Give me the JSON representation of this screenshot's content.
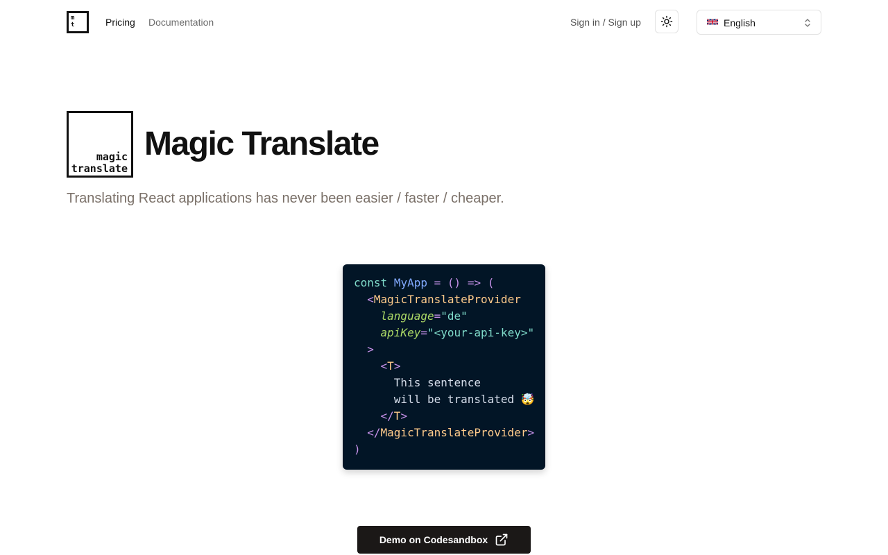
{
  "header": {
    "logo_lines": [
      "m",
      "t"
    ],
    "nav": [
      {
        "label": "Pricing"
      },
      {
        "label": "Documentation"
      }
    ],
    "auth_label": "Sign in / Sign up",
    "theme_icon": "sun-icon",
    "language": {
      "selected": "English",
      "flag_icon": "uk-flag-icon"
    }
  },
  "hero": {
    "logo_lines": [
      "magic",
      "translate"
    ],
    "title": "Magic Translate",
    "tagline": "Translating React applications has never been easier / faster / cheaper."
  },
  "code_sample": {
    "lines": [
      [
        "const",
        "MyApp",
        "=",
        "()",
        "=>",
        "("
      ],
      [
        "<",
        "MagicTranslateProvider"
      ],
      [
        "language",
        "=",
        "\"de\""
      ],
      [
        "apiKey",
        "=",
        "\"<your-api-key>\""
      ],
      [
        ">"
      ],
      [
        "<",
        "T",
        ">"
      ],
      [
        "This sentence"
      ],
      [
        "will be translated 🤯"
      ],
      [
        "</",
        "T",
        ">"
      ],
      [
        "</",
        "MagicTranslateProvider",
        ">"
      ],
      [
        ")"
      ]
    ]
  },
  "cta": {
    "label": "Demo on Codesandbox",
    "icon": "external-link-icon"
  },
  "colors": {
    "background": "#ffffff",
    "text": "#111111",
    "muted": "#7a7068",
    "code_bg": "#021526",
    "cta_bg": "#1b1817"
  }
}
